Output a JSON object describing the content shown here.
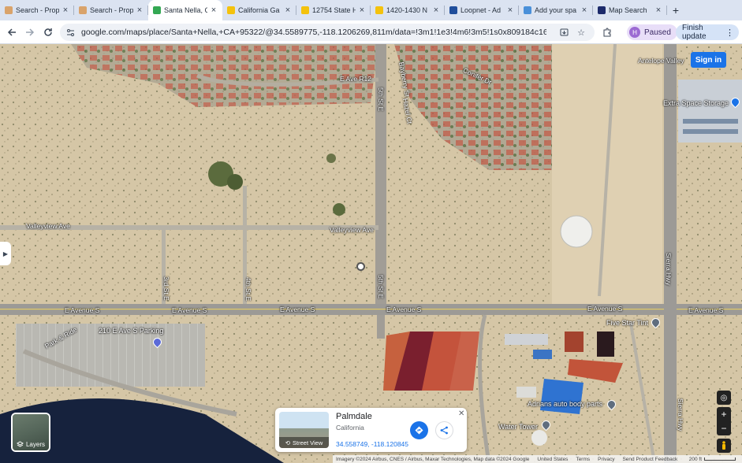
{
  "tabs": [
    {
      "title": "Search - Prop",
      "favicon": "crexi-icon",
      "color": "#d9a36b",
      "active": false
    },
    {
      "title": "Search - Prop",
      "favicon": "crexi-icon",
      "color": "#d9a36b",
      "active": false
    },
    {
      "title": "Santa Nella, C",
      "favicon": "google-maps-icon",
      "color": "#34a853",
      "active": true
    },
    {
      "title": "California Ga",
      "favicon": "s-logo-icon",
      "color": "#f4c20d",
      "active": false
    },
    {
      "title": "12754 State H",
      "favicon": "s-logo-icon",
      "color": "#f4c20d",
      "active": false
    },
    {
      "title": "1420-1430 N",
      "favicon": "s-logo-icon",
      "color": "#f4c20d",
      "active": false
    },
    {
      "title": "Loopnet - Ad",
      "favicon": "loopnet-icon",
      "color": "#1f4e9c",
      "active": false
    },
    {
      "title": "Add your spa",
      "favicon": "upload-icon",
      "color": "#4a90d9",
      "active": false
    },
    {
      "title": "Map Search",
      "favicon": "map-search-icon",
      "color": "#1c2a6b",
      "active": false
    }
  ],
  "toolbar": {
    "url": "google.com/maps/place/Santa+Nella,+CA+95322/@34.5589775,-118.1206269,811m/data=!3m1!1e3!4m6!3m5!1s0x809184c16763bdb3:0",
    "profile_initial": "H",
    "profile_label": "Paused",
    "finish_update_label": "Finish update"
  },
  "map": {
    "sign_in_label": "Sign in",
    "road_labels": {
      "e_ave_r12": "E Ave R12",
      "valleyview_ave_w": "Valleyview Ave",
      "valleyview_ave_e": "Valleyview Ave",
      "e_avenue_s_1": "E Avenue S",
      "e_avenue_s_2": "E Avenue S",
      "e_avenue_s_3": "E Avenue S",
      "e_avenue_s_4": "E Avenue S",
      "e_avenue_s_5": "E Avenue S",
      "e_avenue_s_6": "E Avenue S",
      "fifth_st_e_n": "5th St E",
      "fifth_st_e_s": "5th St E",
      "third_st_e": "3rd St E",
      "fourth_st_e": "4th St E",
      "sierra_hwy_n": "Sierra Hwy",
      "sierra_hwy_s": "Sierra Hwy",
      "bayberry_st": "Bayberry St",
      "hazel_ct": "Hazel Ct",
      "conifer_dr": "Conifer Dr",
      "parks_ride": "Park & Ride",
      "antelope_valley": "Antelope Valley"
    },
    "pois": {
      "extra_space": "Extra Space Storage",
      "five_star_tint": "Five Star Tint",
      "park_ride_parking": "210 E Ave S Parking",
      "adrians": "Adrians auto body parts",
      "water_tower": "Water Tower"
    },
    "layers_label": "Layers",
    "place_card": {
      "name": "Palmdale",
      "region": "California",
      "coords": "34.558749, -118.120845",
      "street_view_label": "Street View"
    },
    "attribution": {
      "imagery": "Imagery ©2024 Airbus, CNES / Airbus, Maxar Technologies, Map data ©2024 Google",
      "united_states": "United States",
      "terms": "Terms",
      "privacy": "Privacy",
      "feedback": "Send Product Feedback",
      "scale": "200 ft"
    }
  }
}
